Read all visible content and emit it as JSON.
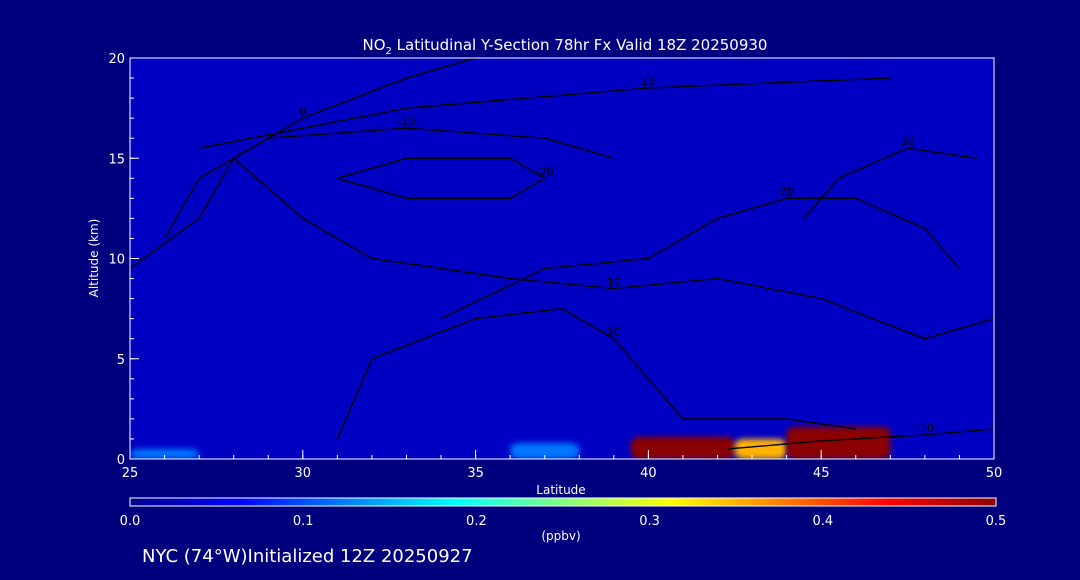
{
  "chart_data": {
    "type": "heatmap",
    "title_prefix": "NO",
    "title_subscript": "2",
    "title_rest": " Latitudinal Y-Section 78hr  Fx Valid 18Z 20250930",
    "xlabel": "Latitude",
    "ylabel": "Altitude (km)",
    "xlim": [
      25,
      50
    ],
    "ylim": [
      0,
      20
    ],
    "x_ticks": [
      "25",
      "30",
      "35",
      "40",
      "45",
      "50"
    ],
    "y_ticks": [
      "0",
      "5",
      "10",
      "15",
      "20"
    ],
    "colorbar": {
      "label": "(ppbv)",
      "range": [
        0.0,
        0.5
      ],
      "ticks": [
        "0.0",
        "0.1",
        "0.2",
        "0.3",
        "0.4",
        "0.5"
      ],
      "colors": [
        "#00008b",
        "#0000ff",
        "#0080ff",
        "#00ffff",
        "#80ff80",
        "#ffff00",
        "#ff8000",
        "#ff0000",
        "#8b0000"
      ]
    },
    "grid": false,
    "background_value": 0.03,
    "features": [
      {
        "lat_range": [
          39.5,
          42.5
        ],
        "alt_range": [
          0,
          1.1
        ],
        "value": 0.5
      },
      {
        "lat_range": [
          42.5,
          44
        ],
        "alt_range": [
          0,
          1.0
        ],
        "value": 0.35
      },
      {
        "lat_range": [
          44,
          47
        ],
        "alt_range": [
          0,
          1.6
        ],
        "value": 0.5
      },
      {
        "lat_range": [
          36,
          38
        ],
        "alt_range": [
          0,
          0.8
        ],
        "value": 0.12
      },
      {
        "lat_range": [
          25,
          27
        ],
        "alt_range": [
          0,
          0.5
        ],
        "value": 0.12
      }
    ],
    "contours": [
      {
        "label": "-10",
        "points": [
          [
            26,
            11
          ],
          [
            27,
            14
          ],
          [
            29,
            16
          ],
          [
            33,
            16.5
          ],
          [
            37,
            16
          ],
          [
            39,
            15
          ]
        ]
      },
      {
        "label": "-20",
        "points": [
          [
            31,
            14
          ],
          [
            33,
            15
          ],
          [
            36,
            15
          ],
          [
            37,
            14
          ],
          [
            36,
            13
          ],
          [
            33,
            13
          ],
          [
            31,
            14
          ]
        ]
      },
      {
        "label": "0",
        "points": [
          [
            25,
            9.5
          ],
          [
            27,
            12
          ],
          [
            28,
            15
          ],
          [
            30,
            17
          ],
          [
            33,
            19
          ],
          [
            35,
            20
          ]
        ]
      },
      {
        "label": "10",
        "points": [
          [
            27,
            15.5
          ],
          [
            33,
            17.5
          ],
          [
            40,
            18.5
          ],
          [
            47,
            19
          ]
        ]
      },
      {
        "label": "10",
        "points": [
          [
            28,
            15
          ],
          [
            30,
            12
          ],
          [
            32,
            10
          ],
          [
            36,
            9
          ],
          [
            39,
            8.5
          ],
          [
            42,
            9
          ],
          [
            45,
            8
          ],
          [
            48,
            6
          ],
          [
            50,
            7
          ]
        ]
      },
      {
        "label": "20",
        "points": [
          [
            34,
            7
          ],
          [
            37,
            9.5
          ],
          [
            40,
            10
          ],
          [
            42,
            12
          ],
          [
            44,
            13
          ],
          [
            46,
            13
          ],
          [
            48,
            11.5
          ],
          [
            49,
            9.5
          ]
        ]
      },
      {
        "label": "20",
        "points": [
          [
            31,
            1
          ],
          [
            32,
            5
          ],
          [
            35,
            7
          ],
          [
            37.5,
            7.5
          ],
          [
            39,
            6
          ],
          [
            40.5,
            3
          ],
          [
            41,
            2
          ],
          [
            44,
            2
          ],
          [
            46,
            1.5
          ]
        ]
      },
      {
        "label": "30",
        "points": [
          [
            44.5,
            12
          ],
          [
            45.5,
            14
          ],
          [
            47.5,
            15.5
          ],
          [
            49.5,
            15
          ]
        ]
      },
      {
        "label": "-10",
        "points": [
          [
            42.3,
            0.5
          ],
          [
            45,
            0.9
          ],
          [
            48,
            1.2
          ],
          [
            50,
            1.5
          ]
        ]
      }
    ]
  },
  "footer": {
    "station": "NYC (74°W)",
    "initialized": "Initialized 12Z 20250927"
  }
}
